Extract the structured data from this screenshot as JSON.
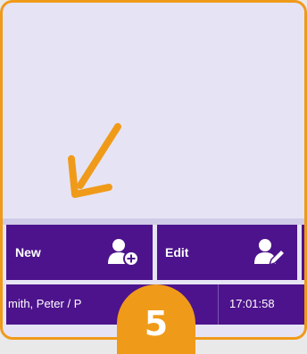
{
  "toolbar": {
    "new_label": "New",
    "edit_label": "Edit",
    "new_icon": "add-user-icon",
    "edit_icon": "edit-user-icon"
  },
  "record": {
    "name": "mith, Peter / P",
    "time": "17:01:58"
  },
  "annotation": {
    "step": "5",
    "arrow_icon": "arrow-down-left-icon"
  },
  "colors": {
    "accent": "#f09a1a",
    "toolbar": "#4d138c",
    "background": "#e6e4f4"
  }
}
